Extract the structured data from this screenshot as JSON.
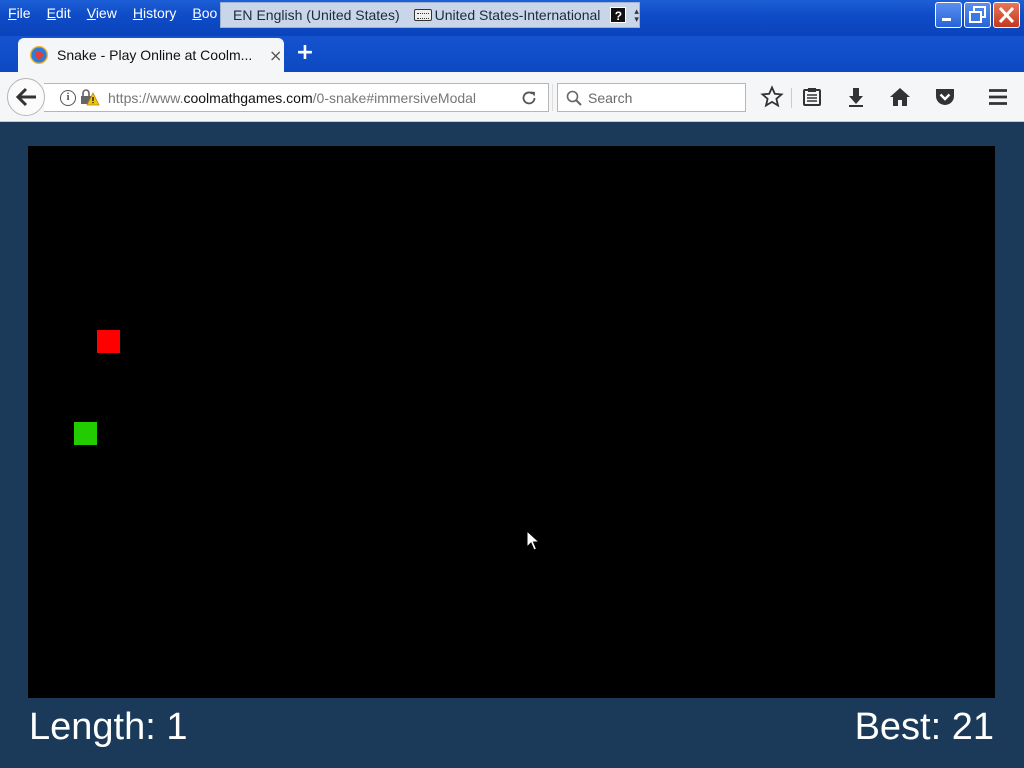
{
  "menu": {
    "items": [
      "File",
      "Edit",
      "View",
      "History",
      "Boo"
    ]
  },
  "language_bar": {
    "code": "EN",
    "language": "English (United States)",
    "keyboard": "United States-International",
    "help": "?"
  },
  "window_controls": {
    "minimize_icon": "minimize-icon",
    "restore_icon": "restore-icon",
    "close_icon": "close-icon"
  },
  "tab": {
    "title": "Snake - Play Online at Coolm...",
    "close": "×",
    "new_tab": "+"
  },
  "navbar": {
    "url_prefix": "https://www.",
    "url_domain": "coolmathgames.com",
    "url_path": "/0-snake#immersiveModal",
    "search_placeholder": "Search"
  },
  "game": {
    "colors": {
      "background": "#000000",
      "food": "#ff0000",
      "snake": "#22cc00",
      "page": "#1b3a59"
    },
    "length_text": "Length: 1",
    "best_text": "Best: 21"
  }
}
